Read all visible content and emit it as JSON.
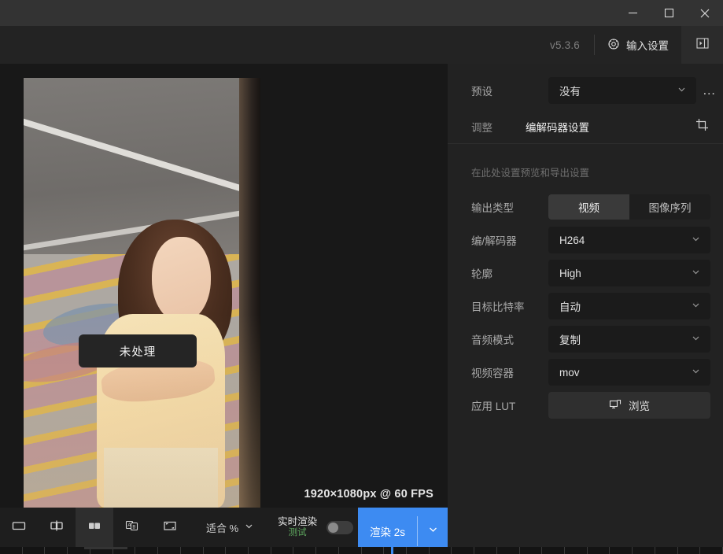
{
  "titlebar": {
    "minimize_label": "minimize",
    "maximize_label": "maximize",
    "close_label": "close"
  },
  "topbar": {
    "version": "v5.3.6",
    "input_settings_label": "输入设置",
    "panel_toggle_label": "panel-toggle"
  },
  "preview": {
    "badge_label": "未处理",
    "resolution": "1920×1080px @ 60 FPS"
  },
  "panel": {
    "preset_label": "预设",
    "preset_value": "没有",
    "more_label": "…",
    "tabs": [
      {
        "label": "调整",
        "active": false
      },
      {
        "label": "编解码器设置",
        "active": true
      }
    ],
    "crop_icon_label": "crop-icon",
    "hint": "在此处设置预览和导出设置",
    "output_type": {
      "label": "输出类型",
      "options": [
        "视频",
        "图像序列"
      ],
      "selected": "视频"
    },
    "fields": [
      {
        "label": "编/解码器",
        "value": "H264"
      },
      {
        "label": "轮廓",
        "value": "High"
      },
      {
        "label": "目标比特率",
        "value": "自动"
      },
      {
        "label": "音频模式",
        "value": "复制"
      },
      {
        "label": "视频容器",
        "value": "mov"
      }
    ],
    "lut": {
      "label": "应用 LUT",
      "button_label": "浏览"
    }
  },
  "bottombar": {
    "view_buttons": [
      {
        "name": "single-view",
        "active": false
      },
      {
        "name": "split-view",
        "active": false
      },
      {
        "name": "side-by-side-view",
        "active": true
      },
      {
        "name": "ab-compare-view",
        "active": false
      },
      {
        "name": "fullscreen-view",
        "active": false
      }
    ],
    "zoom_label": "适合 %",
    "realtime_title": "实时渲染",
    "realtime_beta": "测试",
    "realtime_enabled": false,
    "render_label": "渲染 2s"
  },
  "colors": {
    "accent": "#3d8bf2",
    "beta_green": "#5fa85f",
    "panel_bg": "#222222",
    "canvas_bg": "#181818",
    "titlebar_bg": "#333333"
  }
}
